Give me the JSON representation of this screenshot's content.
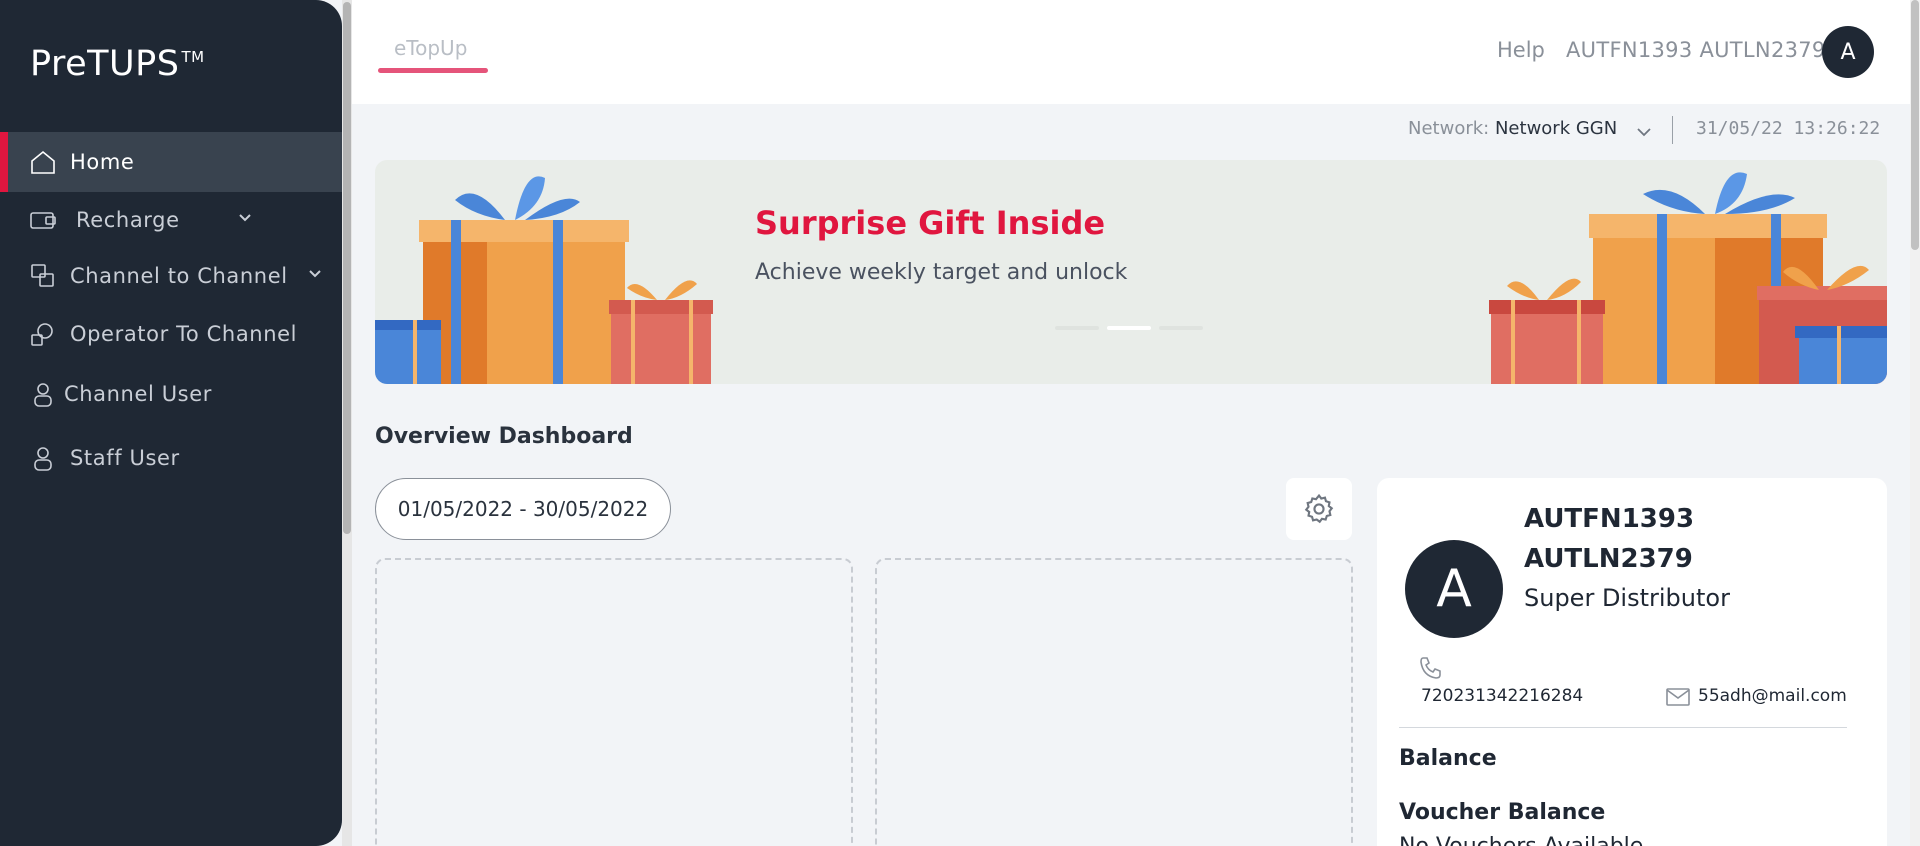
{
  "app": {
    "brand": "PreTUPS",
    "brand_mark": "TM"
  },
  "sidebar": {
    "items": [
      {
        "label": "Home",
        "icon": "home-icon",
        "active": true
      },
      {
        "label": "Recharge",
        "icon": "recharge-icon",
        "has_submenu": true
      },
      {
        "label": "Channel to Channel",
        "icon": "channel-transfer-icon",
        "has_submenu": true
      },
      {
        "label": "Operator To Channel",
        "icon": "operator-icon"
      },
      {
        "label": "Channel User",
        "icon": "user-icon"
      },
      {
        "label": "Staff User",
        "icon": "staff-user-icon"
      }
    ]
  },
  "header": {
    "tab": "eTopUp",
    "help": "Help",
    "user_name": "AUTFN1393 AUTLN2379",
    "avatar_letter": "A"
  },
  "network": {
    "label": "Network:",
    "value": "Network GGN",
    "datetime": "31/05/22 13:26:22"
  },
  "banner": {
    "title": "Surprise Gift Inside",
    "subtitle": "Achieve weekly target and unlock",
    "active_slide": 2,
    "slide_count": 3
  },
  "overview": {
    "title": "Overview Dashboard",
    "date_range": "01/05/2022 - 30/05/2022"
  },
  "profile": {
    "avatar_letter": "A",
    "first_name": "AUTFN1393",
    "last_name": "AUTLN2379",
    "role": "Super Distributor",
    "phone": "720231342216284",
    "email": "55adh@mail.com",
    "balance_label": "Balance",
    "voucher_label": "Voucher Balance",
    "voucher_value": "No Vouchers Available"
  },
  "colors": {
    "sidebar_bg": "#1f2834",
    "accent": "#e0163f",
    "tab_underline": "#e5547a"
  }
}
